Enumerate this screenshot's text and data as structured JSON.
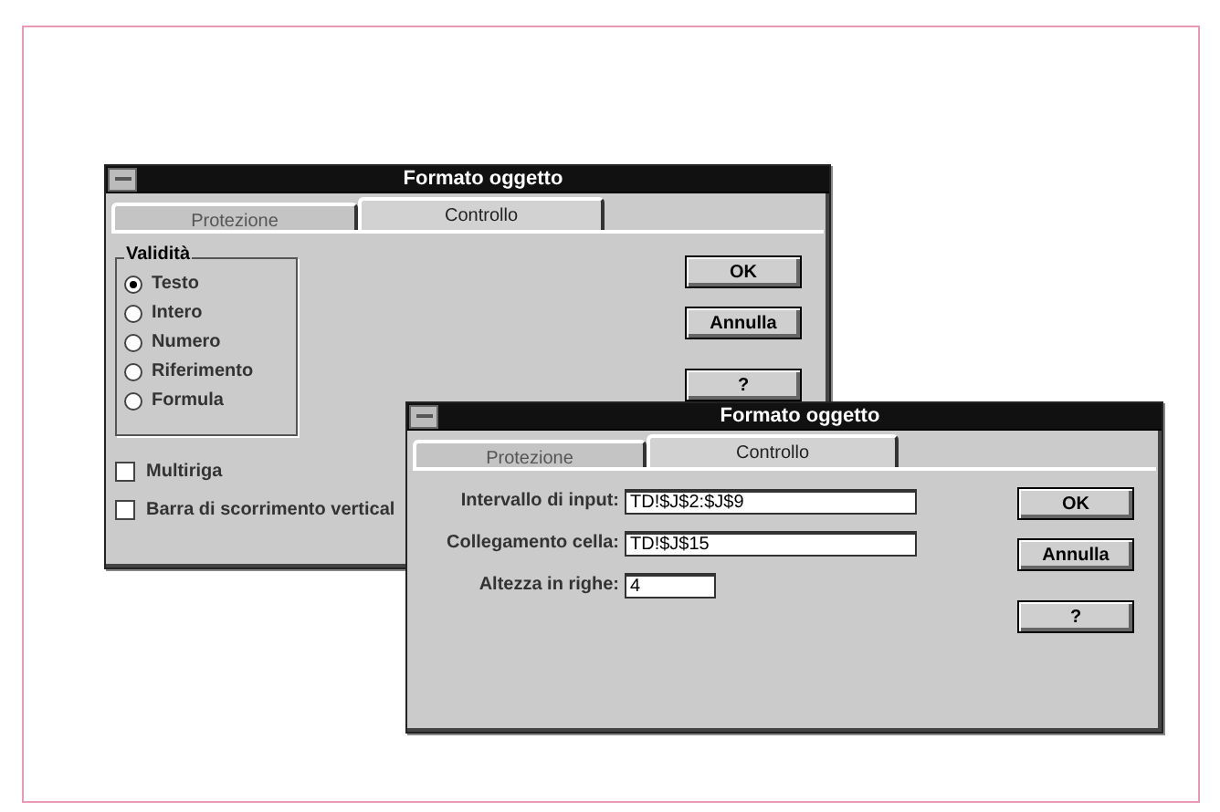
{
  "windows": [
    {
      "kind": "validation",
      "title": "Formato oggetto",
      "tabs": [
        {
          "label": "Protezione",
          "selected": false
        },
        {
          "label": "Controllo",
          "selected": true
        }
      ],
      "group": {
        "label": "Validità",
        "options": [
          {
            "label": "Testo",
            "selected": true
          },
          {
            "label": "Intero",
            "selected": false
          },
          {
            "label": "Numero",
            "selected": false
          },
          {
            "label": "Riferimento",
            "selected": false
          },
          {
            "label": "Formula",
            "selected": false
          }
        ]
      },
      "checkboxes": [
        {
          "label": "Multiriga",
          "checked": false
        },
        {
          "label": "Barra di scorrimento vertical",
          "checked": false
        }
      ],
      "buttons": [
        "OK",
        "Annulla",
        "?"
      ]
    },
    {
      "kind": "link",
      "title": "Formato oggetto",
      "tabs": [
        {
          "label": "Protezione",
          "selected": false
        },
        {
          "label": "Controllo",
          "selected": true
        }
      ],
      "fields": [
        {
          "label": "Intervallo di input:",
          "value": "TD!$J$2:$J$9"
        },
        {
          "label": "Collegamento cella:",
          "value": "TD!$J$15"
        },
        {
          "label": "Altezza in righe:",
          "value": "4"
        }
      ],
      "buttons": [
        "OK",
        "Annulla",
        "?"
      ]
    }
  ]
}
